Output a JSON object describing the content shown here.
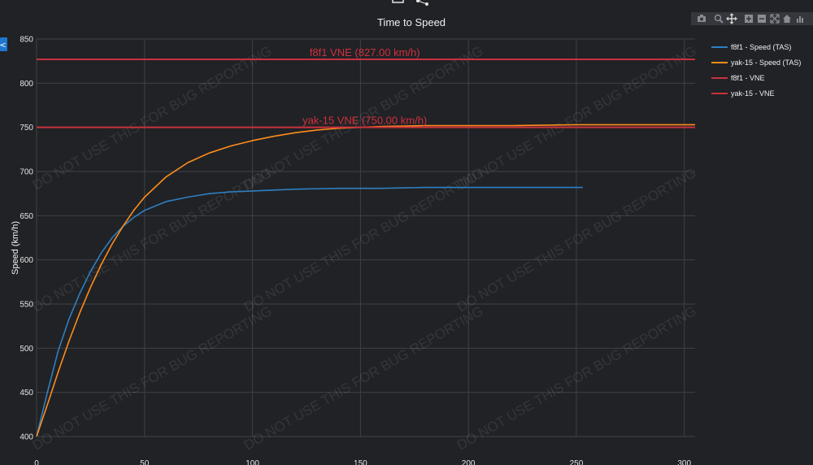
{
  "toolbar": {
    "top_icons": [
      "square-icon",
      "share-icon"
    ],
    "modebar_icons": [
      "camera-icon",
      "zoom-icon",
      "pan-icon",
      "zoom-in-icon",
      "zoom-out-icon",
      "autoscale-icon",
      "home-icon",
      "bar-chart-icon"
    ]
  },
  "side_tab": {
    "label": "<",
    "color": "#1f77d0"
  },
  "watermark": "DO NOT USE THIS FOR BUG REPORTING",
  "chart_data": {
    "type": "line",
    "title": "Time to Speed",
    "xlabel": "",
    "ylabel": "Speed (km/h)",
    "xlim": [
      0,
      305
    ],
    "ylim": [
      400,
      850
    ],
    "xticks": [
      0,
      50,
      100,
      150,
      200,
      250,
      300
    ],
    "yticks": [
      400,
      450,
      500,
      550,
      600,
      650,
      700,
      750,
      800,
      850
    ],
    "grid": true,
    "legend_position": "top-right",
    "series": [
      {
        "name": "f8f1 - Speed (TAS)",
        "color": "#2f7fc1",
        "x": [
          0,
          5,
          10,
          15,
          20,
          25,
          30,
          35,
          40,
          45,
          50,
          60,
          70,
          80,
          90,
          100,
          120,
          140,
          160,
          180,
          200,
          220,
          240,
          253
        ],
        "y": [
          400,
          450,
          497,
          533,
          562,
          587,
          608,
          625,
          638,
          648,
          656,
          666,
          671,
          675,
          677,
          678,
          680,
          681,
          681,
          682,
          682,
          682,
          682,
          682
        ]
      },
      {
        "name": "yak-15 - Speed (TAS)",
        "color": "#ff8c1a",
        "x": [
          0,
          5,
          10,
          15,
          20,
          25,
          30,
          35,
          40,
          45,
          50,
          60,
          70,
          80,
          90,
          100,
          110,
          120,
          130,
          140,
          150,
          160,
          180,
          200,
          220,
          250,
          280,
          305
        ],
        "y": [
          400,
          436,
          473,
          508,
          540,
          569,
          595,
          618,
          638,
          656,
          671,
          694,
          710,
          721,
          729,
          735,
          740,
          744,
          747,
          749,
          750,
          751,
          752,
          752,
          752,
          753,
          753,
          753
        ]
      },
      {
        "name": "f8f1 - VNE",
        "color": "#c8323c",
        "x": [
          0,
          305
        ],
        "y": [
          827,
          827
        ]
      },
      {
        "name": "yak-15 - VNE",
        "color": "#c8323c",
        "x": [
          0,
          305
        ],
        "y": [
          750,
          750
        ]
      }
    ],
    "annotations": [
      {
        "text": "f8f1 VNE (827.00 km/h)",
        "x": 152,
        "y": 827
      },
      {
        "text": "yak-15 VNE (750.00 km/h)",
        "x": 152,
        "y": 750
      }
    ]
  }
}
